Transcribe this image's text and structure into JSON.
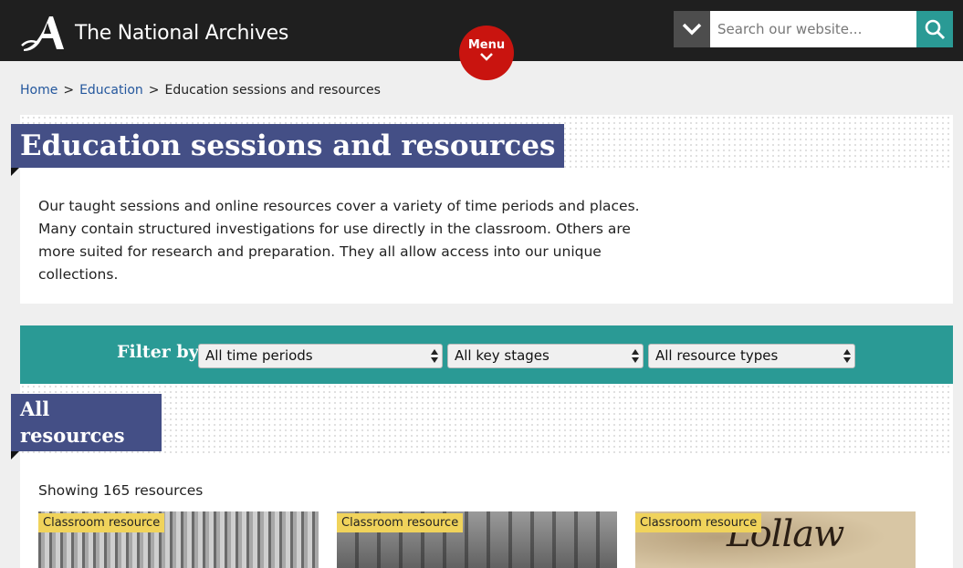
{
  "header": {
    "site_name": "The National Archives",
    "menu_label": "Menu",
    "search": {
      "placeholder": "Search our website..."
    },
    "colors": {
      "bar": "#1f1f1f",
      "menu": "#c9140f",
      "search_button": "#2a9a95"
    }
  },
  "breadcrumb": {
    "items": [
      {
        "label": "Home"
      },
      {
        "label": "Education"
      },
      {
        "label": "Education sessions and resources"
      }
    ],
    "separator": ">"
  },
  "page": {
    "title": "Education sessions and resources",
    "intro": "Our taught sessions and online resources cover a variety of time periods and places. Many contain structured investigations for use directly in the classroom. Others are more suited for research and preparation. They all allow access into our unique collections."
  },
  "filter": {
    "label": "Filter by",
    "selects": [
      {
        "value": "All time periods"
      },
      {
        "value": "All key stages"
      },
      {
        "value": "All resource types"
      }
    ],
    "color": "#2a9a95"
  },
  "results": {
    "heading": "All resources",
    "count_text": "Showing 165 resources",
    "cards": [
      {
        "badge": "Classroom resource",
        "image_icon": "engraving-image"
      },
      {
        "badge": "Classroom resource",
        "image_icon": "engraving-image"
      },
      {
        "badge": "Classroom resource",
        "image_icon": "manuscript-image",
        "image_text": "Lollaw"
      }
    ]
  }
}
